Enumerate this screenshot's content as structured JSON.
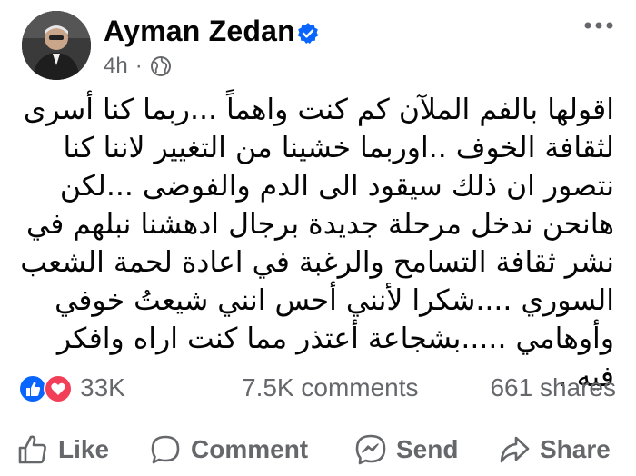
{
  "post": {
    "author": "Ayman Zedan",
    "verified": true,
    "time": "4h",
    "meta_separator": "·",
    "audience_icon": "globe-icon",
    "text": "اقولها بالفم الملآن كم كنت واهماً ...ربما كنا أسرى\nلثقافة الخوف ..اوربما خشينا من التغيير لاننا كنا\nنتصور ان ذلك سيقود الى الدم والفوضى ...لكن\nهانحن ندخل مرحلة جديدة برجال ادهشنا نبلهم في\nنشر ثقافة التسامح والرغبة في اعادة لحمة الشعب\nالسوري ....شكرا لأنني أحس انني شيعتُ خوفي\nوأوهامي .....بشجاعة أعتذر مما كنت اراه وافكر فيه ."
  },
  "stats": {
    "reactions": "33K",
    "reaction_icons": [
      "like-icon",
      "love-icon"
    ],
    "comments": "7.5K comments",
    "shares": "661 shares"
  },
  "actions": {
    "like": "Like",
    "comment": "Comment",
    "send": "Send",
    "share": "Share"
  },
  "colors": {
    "text": "#050505",
    "secondary": "#65676b",
    "verified": "#0866ff",
    "like": "#0866ff",
    "love": "#f33e58"
  }
}
